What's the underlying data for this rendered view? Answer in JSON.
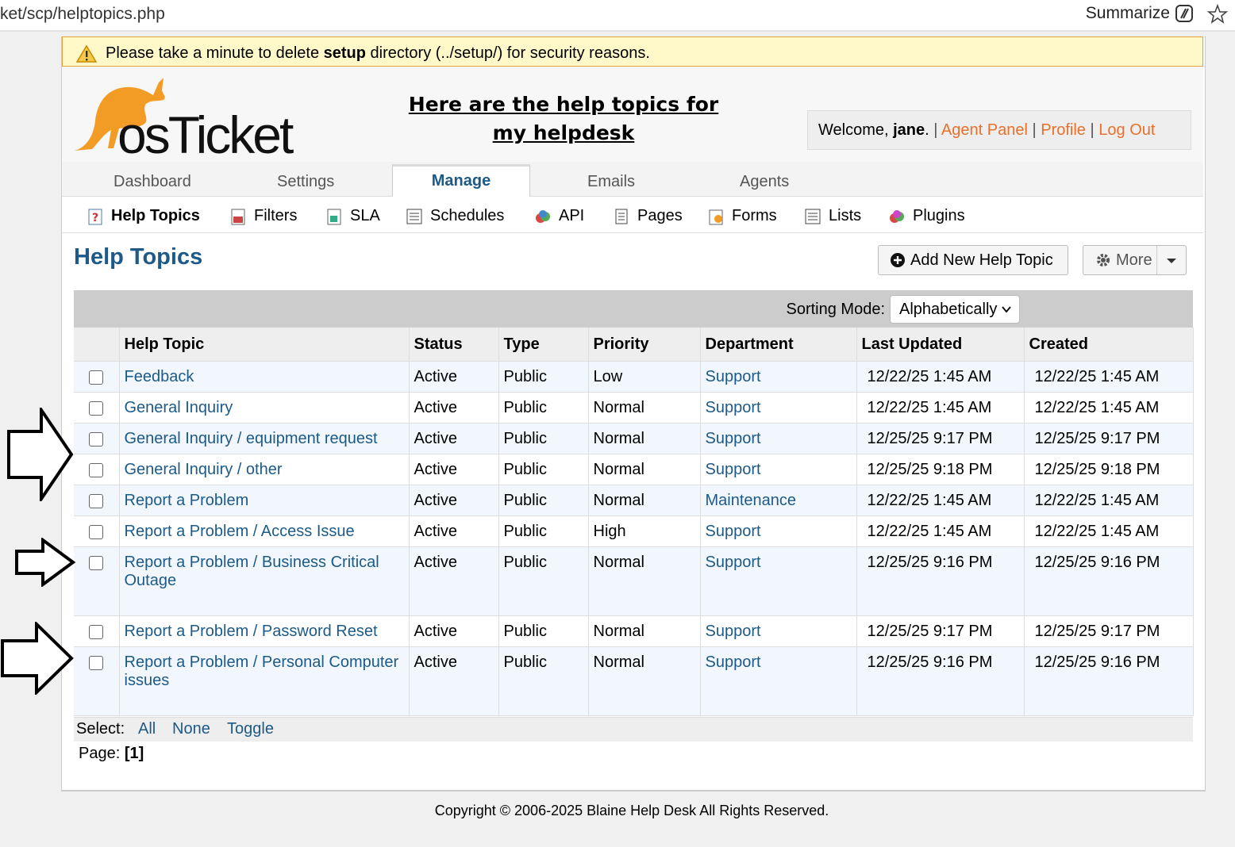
{
  "browser": {
    "url": "ket/scp/helptopics.php",
    "summarize_label": "Summarize"
  },
  "warning": {
    "prefix": "Please take a minute to delete ",
    "bold": "setup",
    "suffix": " directory (../setup/) for security reasons."
  },
  "header": {
    "headline_line1": "Here are the help topics for",
    "headline_line2": "my helpdesk",
    "welcome_prefix": "Welcome, ",
    "user": "jane",
    "welcome_dot": ".",
    "links": [
      "Agent Panel",
      "Profile",
      "Log Out"
    ]
  },
  "tabs": [
    "Dashboard",
    "Settings",
    "Manage",
    "Emails",
    "Agents"
  ],
  "active_tab": "Manage",
  "subnav": [
    "Help Topics",
    "Filters",
    "SLA",
    "Schedules",
    "API",
    "Pages",
    "Forms",
    "Lists",
    "Plugins"
  ],
  "page": {
    "title": "Help Topics",
    "add_button": "Add New Help Topic",
    "more_button": "More",
    "sorting_label": "Sorting Mode:",
    "sorting_value": "Alphabetically"
  },
  "table": {
    "headers": [
      "Help Topic",
      "Status",
      "Type",
      "Priority",
      "Department",
      "Last Updated",
      "Created"
    ],
    "rows": [
      {
        "topic": "Feedback",
        "status": "Active",
        "type": "Public",
        "priority": "Low",
        "dept": "Support",
        "updated": "12/22/25 1:45 AM",
        "created": "12/22/25 1:45 AM"
      },
      {
        "topic": "General Inquiry",
        "status": "Active",
        "type": "Public",
        "priority": "Normal",
        "dept": "Support",
        "updated": "12/22/25 1:45 AM",
        "created": "12/22/25 1:45 AM"
      },
      {
        "topic": "General Inquiry / equipment request",
        "status": "Active",
        "type": "Public",
        "priority": "Normal",
        "dept": "Support",
        "updated": "12/25/25 9:17 PM",
        "created": "12/25/25 9:17 PM"
      },
      {
        "topic": "General Inquiry / other",
        "status": "Active",
        "type": "Public",
        "priority": "Normal",
        "dept": "Support",
        "updated": "12/25/25 9:18 PM",
        "created": "12/25/25 9:18 PM"
      },
      {
        "topic": "Report a Problem",
        "status": "Active",
        "type": "Public",
        "priority": "Normal",
        "dept": "Maintenance",
        "updated": "12/22/25 1:45 AM",
        "created": "12/22/25 1:45 AM"
      },
      {
        "topic": "Report a Problem / Access Issue",
        "status": "Active",
        "type": "Public",
        "priority": "High",
        "dept": "Support",
        "updated": "12/22/25 1:45 AM",
        "created": "12/22/25 1:45 AM"
      },
      {
        "topic": "Report a Problem / Business Critical Outage",
        "status": "Active",
        "type": "Public",
        "priority": "Normal",
        "dept": "Support",
        "updated": "12/25/25 9:16 PM",
        "created": "12/25/25 9:16 PM"
      },
      {
        "topic": "Report a Problem / Password Reset",
        "status": "Active",
        "type": "Public",
        "priority": "Normal",
        "dept": "Support",
        "updated": "12/25/25 9:17 PM",
        "created": "12/25/25 9:17 PM"
      },
      {
        "topic": "Report a Problem / Personal Computer issues",
        "status": "Active",
        "type": "Public",
        "priority": "Normal",
        "dept": "Support",
        "updated": "12/25/25 9:16 PM",
        "created": "12/25/25 9:16 PM"
      }
    ]
  },
  "select_bar": {
    "label": "Select:",
    "links": [
      "All",
      "None",
      "Toggle"
    ]
  },
  "pager": {
    "label": "Page:",
    "current": "[1]"
  },
  "footer": "Copyright © 2006-2025 Blaine Help Desk All Rights Reserved.",
  "colors": {
    "link": "#1d5a87",
    "header_link": "#e8702a",
    "warning_bg": "#fff9c9",
    "row_alt": "#f1f7fd",
    "logo_orange": "#f39c25"
  },
  "icons": [
    "warning-icon",
    "summarize-icon",
    "star-icon",
    "plus-circle-icon",
    "gear-icon",
    "chevron-down-icon",
    "arrow-right-icon"
  ]
}
